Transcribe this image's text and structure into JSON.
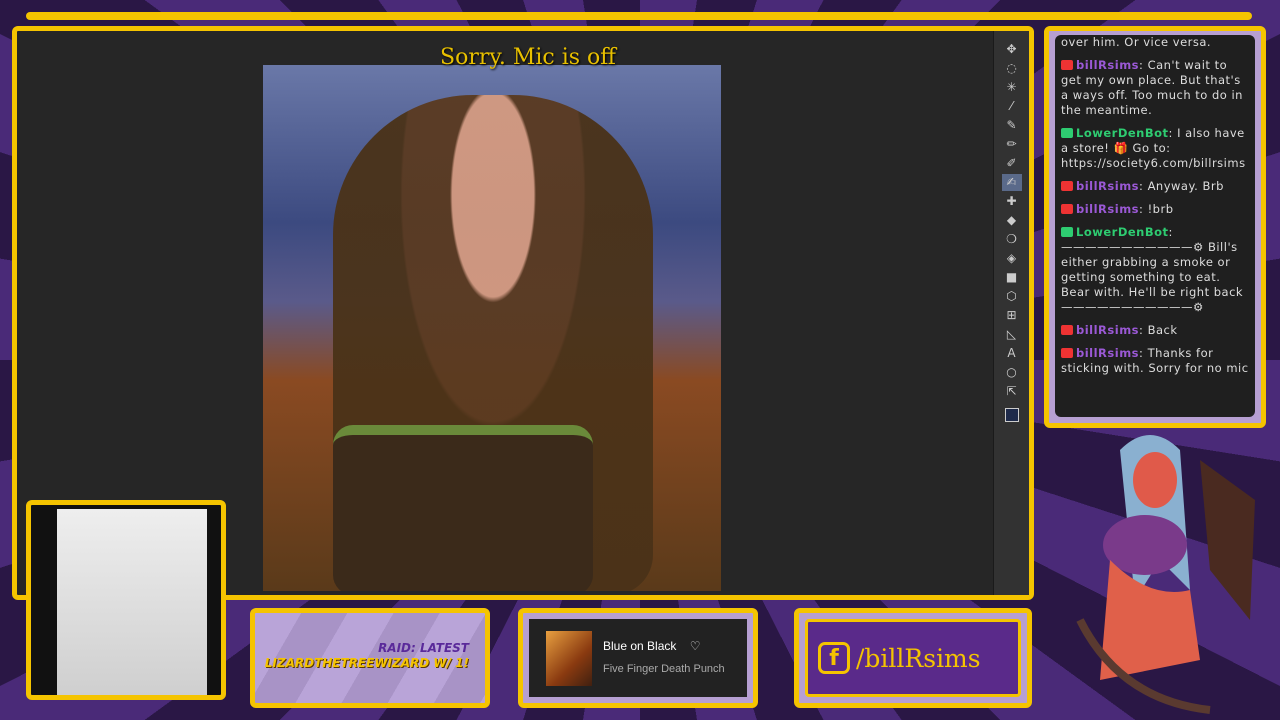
{
  "overlay": {
    "mic_notice": "Sorry. Mic is off",
    "accent": "#f5c400",
    "panel": "#b69fd2"
  },
  "toolbar": {
    "tools": [
      "move-icon",
      "lasso-icon",
      "magic-wand-icon",
      "eyedropper-icon",
      "pen-icon",
      "pencil-icon",
      "brush-icon",
      "smudge-icon",
      "heal-icon",
      "eraser-icon",
      "fill-icon",
      "bucket-icon",
      "gradient-icon",
      "shape-icon",
      "frame-icon",
      "vector-icon",
      "text-icon",
      "speech-icon",
      "transform-icon"
    ],
    "foreground": "#1e2a4a",
    "background": "#e8b0a0"
  },
  "chat": {
    "messages": [
      {
        "user": "",
        "badge": "",
        "text": "over him. Or vice versa."
      },
      {
        "user": "billRsims",
        "badge": "broadcaster",
        "text": "Can't wait to get my own place. But that's a ways off. Too much to do in the meantime."
      },
      {
        "user": "LowerDenBot",
        "badge": "moderator",
        "text": "I also have a store! 🎁 Go to: https://society6.com/billrsims"
      },
      {
        "user": "billRsims",
        "badge": "broadcaster",
        "text": "Anyway. Brb"
      },
      {
        "user": "billRsims",
        "badge": "broadcaster",
        "text": "!brb"
      },
      {
        "user": "LowerDenBot",
        "badge": "moderator",
        "text": "———————————⚙ Bill's either grabbing a smoke or getting something to eat. Bear with. He'll be right back ———————————⚙"
      },
      {
        "user": "billRsims",
        "badge": "broadcaster",
        "text": "Back"
      },
      {
        "user": "billRsims",
        "badge": "broadcaster",
        "text": "Thanks for sticking with. Sorry for no mic"
      }
    ],
    "colors": {
      "billRsims": "#9b59d6",
      "LowerDenBot": "#2ecc71"
    }
  },
  "raid": {
    "line1": "RAID: LATEST",
    "line2": "LIZARDTHETREEWIZARD W/ 1!"
  },
  "music": {
    "title": "Blue on Black",
    "artist": "Five Finger Death Punch"
  },
  "social": {
    "handle": "/billRsims",
    "icon": "facebook-icon"
  }
}
